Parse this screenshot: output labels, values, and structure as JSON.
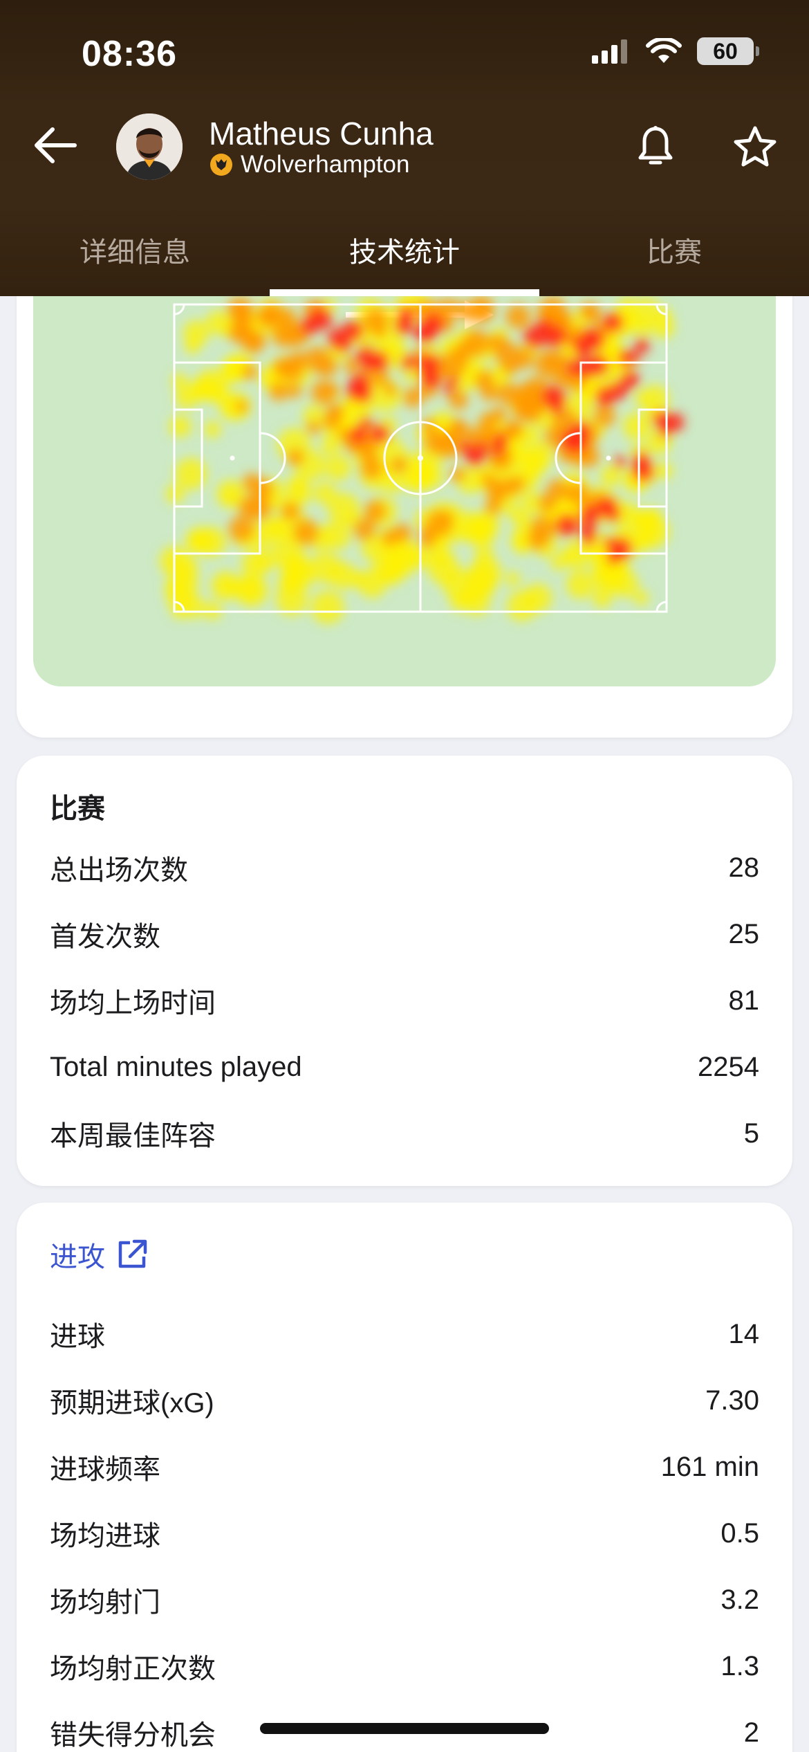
{
  "status_bar": {
    "time": "08:36",
    "battery": "60"
  },
  "header": {
    "player_name": "Matheus Cunha",
    "team": "Wolverhampton"
  },
  "tabs": [
    {
      "label": "详细信息"
    },
    {
      "label": "技术统计"
    },
    {
      "label": "比赛"
    }
  ],
  "match_stats": {
    "title": "比赛",
    "rows": [
      {
        "label": "总出场次数",
        "value": "28"
      },
      {
        "label": "首发次数",
        "value": "25"
      },
      {
        "label": "场均上场时间",
        "value": "81"
      },
      {
        "label": "Total minutes played",
        "value": "2254"
      },
      {
        "label": "本周最佳阵容",
        "value": "5"
      }
    ]
  },
  "attack_stats": {
    "title": "进攻",
    "rows": [
      {
        "label": "进球",
        "value": "14"
      },
      {
        "label": "预期进球(xG)",
        "value": "7.30"
      },
      {
        "label": "进球频率",
        "value": "161 min"
      },
      {
        "label": "场均进球",
        "value": "0.5"
      },
      {
        "label": "场均射门",
        "value": "3.2"
      },
      {
        "label": "场均射正次数",
        "value": "1.3"
      },
      {
        "label": "错失得分机会",
        "value": "2"
      }
    ]
  },
  "colors": {
    "header_bg": "#3a2714",
    "link_blue": "#3b55d1",
    "pitch_bg": "#cde9c5",
    "heat_hot": "#ff2a1a",
    "heat_mid": "#ff9a00",
    "heat_low": "#fff200"
  }
}
